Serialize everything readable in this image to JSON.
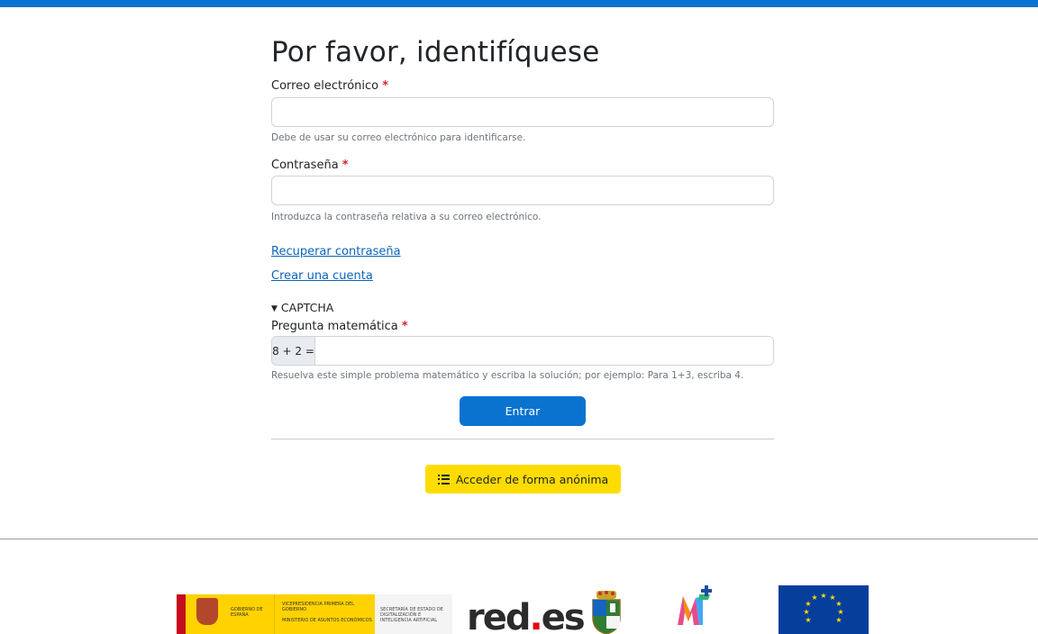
{
  "login": {
    "title": "Por favor, identifíquese",
    "email": {
      "label": "Correo electrónico",
      "required_mark": "*",
      "value": "",
      "help": "Debe de usar su correo electrónico para identificarse."
    },
    "password": {
      "label": "Contraseña",
      "required_mark": "*",
      "value": "",
      "help": "Introduzca la contraseña relativa a su correo electrónico."
    },
    "links": {
      "recover": "Recuperar contraseña",
      "create": "Crear una cuenta"
    },
    "captcha": {
      "toggle_label": "CAPTCHA",
      "math_label": "Pregunta matemática",
      "required_mark": "*",
      "question": "8 + 2 =",
      "value": "",
      "help": "Resuelva este simple problema matemático y escriba la solución; por ejemplo: Para 1+3, escriba 4."
    },
    "submit_label": "Entrar",
    "anonymous_label": "Acceder de forma anónima"
  },
  "footer": {
    "logos": [
      "gobierno-espana-logo",
      "red-es-logo",
      "municipal-crest-logo",
      "mt-plus-logo",
      "eu-flag-logo"
    ],
    "gobierno_name": "GOBIERNO DE ESPAÑA",
    "vicepresidencia": "VICEPRESIDENCIA PRIMERA DEL GOBIERNO",
    "ministerio": "MINISTERIO DE ASUNTOS ECONÓMICOS",
    "secretaria": "SECRETARÍA DE ESTADO DE DIGITALIZACIÓN E INTELIGENCIA ARTIFICIAL",
    "redes_main": "red",
    "redes_dot": ".",
    "redes_tail": "es"
  },
  "colors": {
    "primary": "#0a73d0",
    "accent_yellow": "#ffdc00",
    "required": "#d7262f",
    "link": "#0a63b8"
  }
}
